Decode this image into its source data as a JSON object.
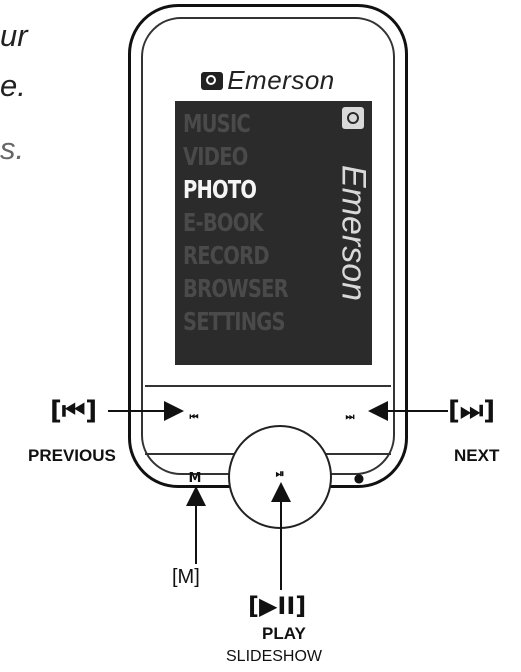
{
  "text_fragments": [
    "ur",
    "e.",
    "s."
  ],
  "device": {
    "brand": "Emerson",
    "screen_menu": [
      "MUSIC",
      "VIDEO",
      "PHOTO",
      "E-BOOK",
      "RECORD",
      "BROWSER",
      "SETTINGS"
    ],
    "selected_item": "PHOTO",
    "buttons": {
      "prev_icon": "⏮",
      "next_icon": "⏭",
      "m_label": "M",
      "play_icon": "⏯",
      "dot": "●"
    }
  },
  "callouts": {
    "previous": {
      "symbol": "[⏮]",
      "label": "PREVIOUS"
    },
    "next": {
      "symbol": "[⏭]",
      "label": "NEXT"
    },
    "m": {
      "label": "[M]"
    },
    "play": {
      "symbol": "[▶II]",
      "label": "PLAY",
      "sublabel": "SLIDESHOW"
    }
  }
}
